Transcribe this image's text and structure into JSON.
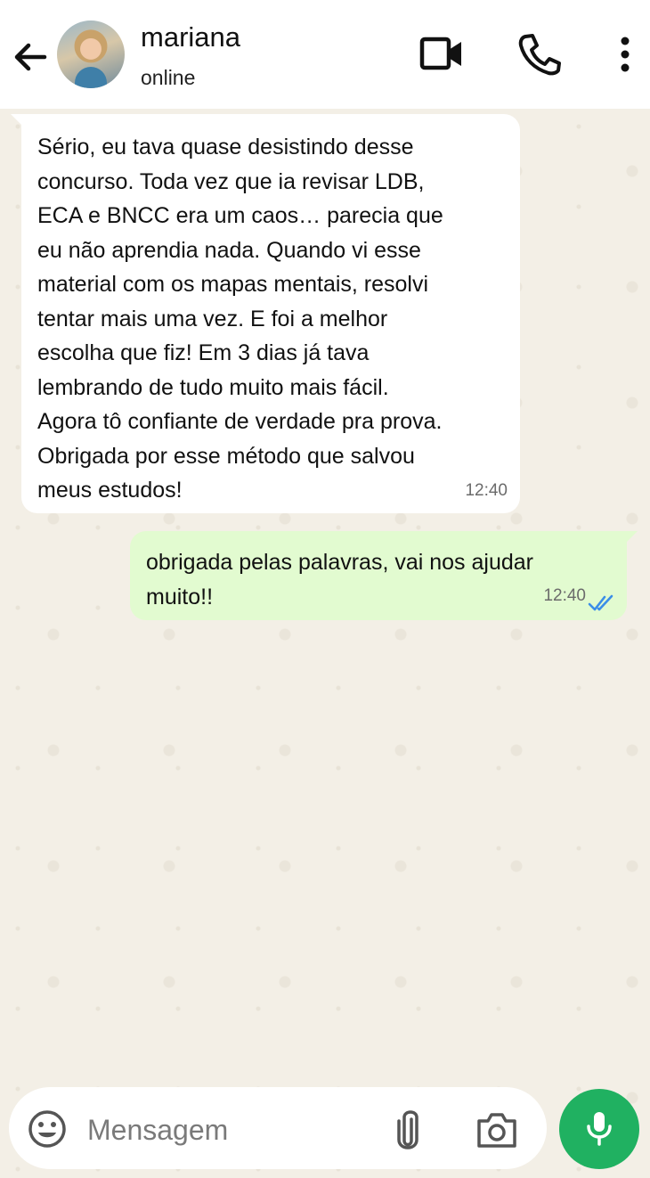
{
  "header": {
    "contact_name": "mariana",
    "status": "online",
    "icons": [
      "back-arrow-icon",
      "video-icon",
      "phone-icon",
      "more-vert-icon"
    ]
  },
  "messages": [
    {
      "direction": "incoming",
      "text": "Sério, eu tava quase desistindo desse\nconcurso. Toda vez que ia revisar LDB,\nECA e BNCC era um caos… parecia que\neu não aprendia nada. Quando vi esse\nmaterial com os mapas mentais, resolvi\ntentar mais uma vez. E foi a melhor\nescolha que fiz! Em 3 dias já tava\nlembrando de tudo muito mais fácil.\nAgora tô confiante de verdade pra prova.\nObrigada por esse método que salvou\nmeus estudos!",
      "time": "12:40"
    },
    {
      "direction": "outgoing",
      "text": "obrigada pelas palavras, vai nos ajudar\nmuito!!",
      "time": "12:40",
      "status": "read"
    }
  ],
  "composer": {
    "placeholder": "Mensagem",
    "value": "",
    "icons": [
      "emoji-icon",
      "paperclip-icon",
      "camera-icon",
      "mic-icon"
    ]
  },
  "colors": {
    "outgoing_bubble": "#e2fbd0",
    "incoming_bubble": "#ffffff",
    "chat_background": "#f3efe6",
    "mic_button": "#20b161",
    "read_ticks": "#3b8ee8"
  }
}
